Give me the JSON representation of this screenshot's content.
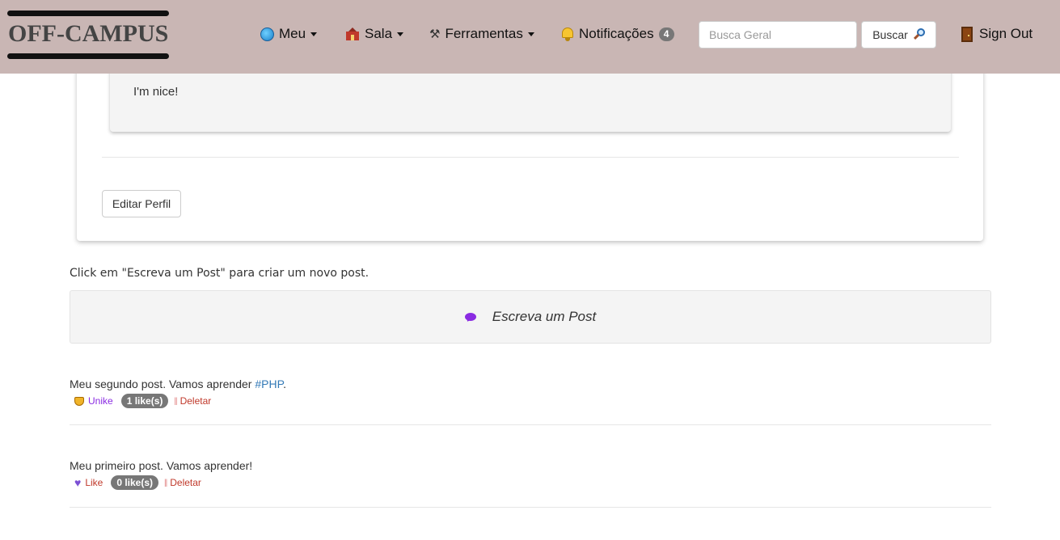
{
  "navbar": {
    "logo_text": "OFF-CAMPUS",
    "menu": [
      {
        "label": "Meu",
        "icon": "globe-icon"
      },
      {
        "label": "Sala",
        "icon": "school-icon"
      },
      {
        "label": "Ferramentas",
        "icon": "tools-icon"
      }
    ],
    "notifications": {
      "label": "Notificações",
      "count": "4",
      "icon": "bell-icon"
    },
    "search": {
      "placeholder": "Busca Geral",
      "value": "",
      "button_label": "Buscar"
    },
    "signout_label": "Sign Out",
    "colors": {
      "navbar_bg": "#c9b6b4"
    }
  },
  "profile": {
    "about_text": "I'm nice!",
    "edit_button_label": "Editar Perfil"
  },
  "posts_section": {
    "hint": "Click em \"Escreva um Post\" para criar um novo post.",
    "write_label": "Escreva um Post",
    "posts": [
      {
        "text": "Meu segundo post. Vamos aprender ",
        "hashtag": "#PHP",
        "trailing": ".",
        "action_label": "Unike",
        "likes": "1 like(s)",
        "delete_label": "Deletar"
      },
      {
        "text": "Meu primeiro post. Vamos aprender!",
        "action_label": "Like",
        "likes": "0 like(s)",
        "delete_label": "Deletar"
      }
    ]
  }
}
